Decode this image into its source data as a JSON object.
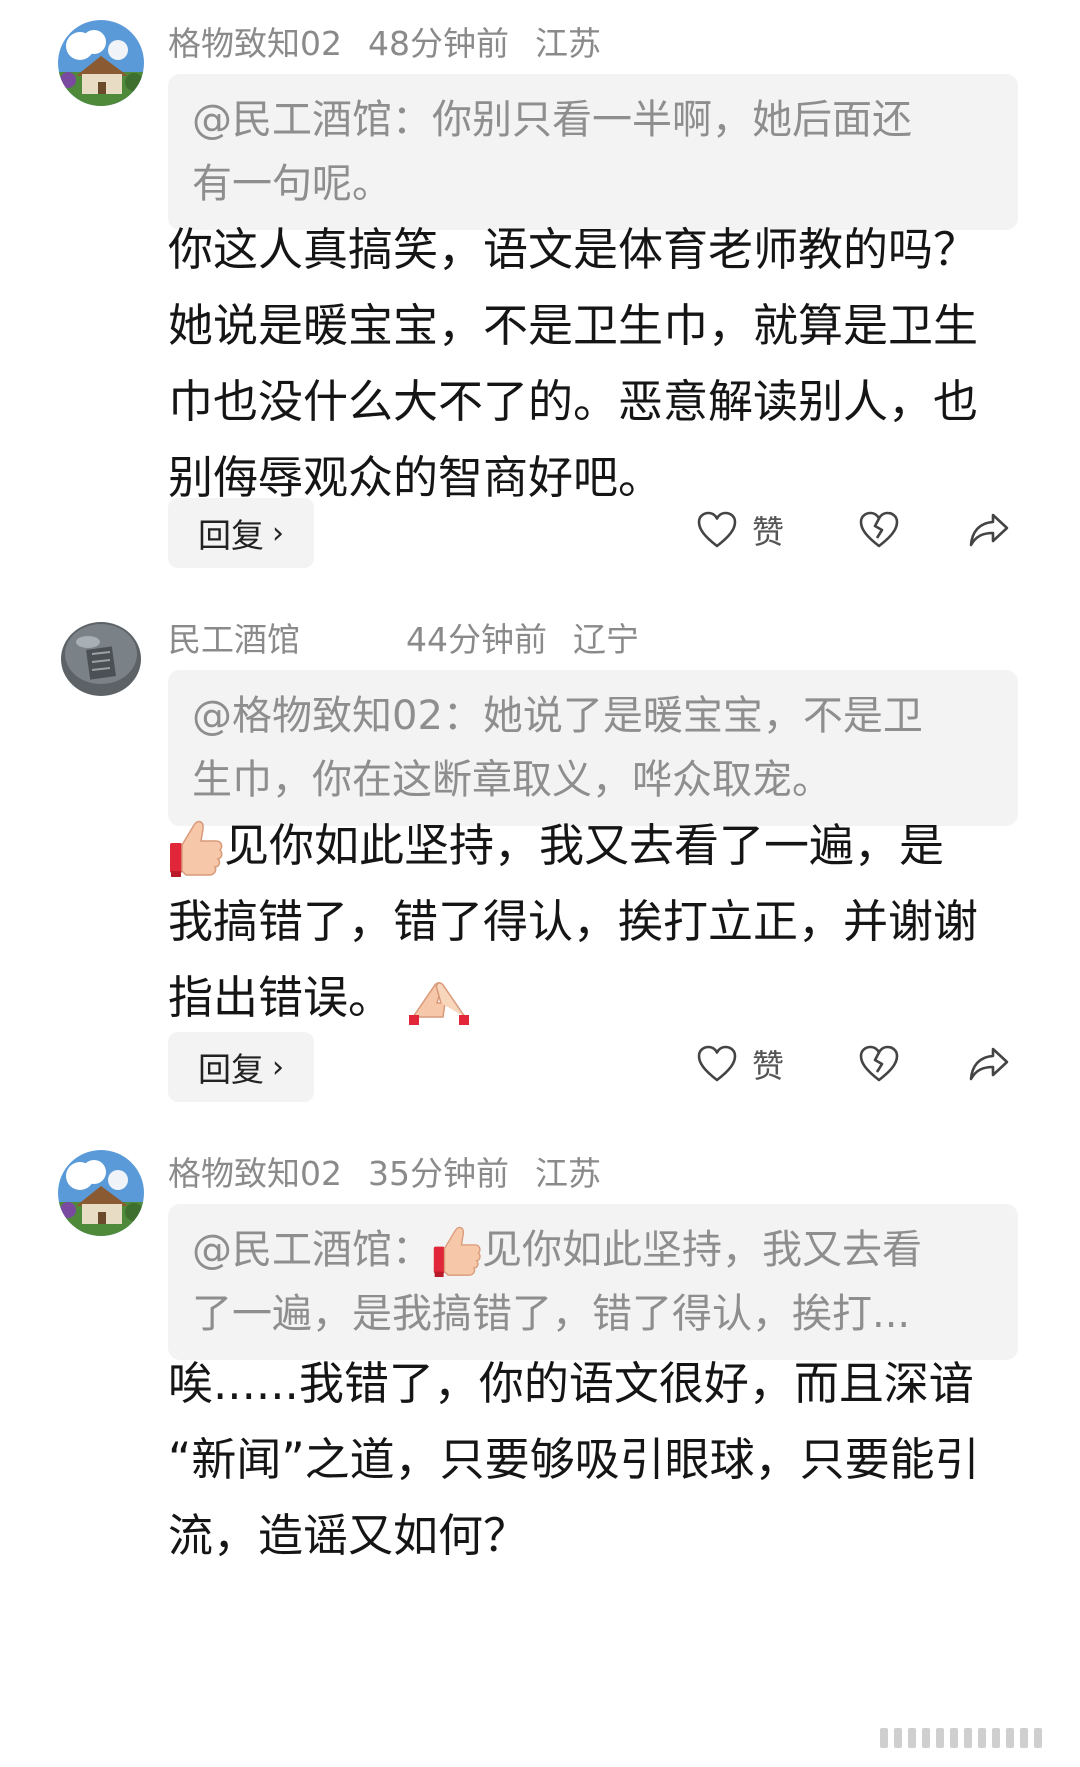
{
  "comments": [
    {
      "username": "格物致知02",
      "time": "48分钟前",
      "location": "江苏",
      "quote_lines": [
        "@民工酒馆：你别只看一半啊，她后面还",
        "有一句呢。"
      ],
      "body_lines": [
        "你这人真搞笑，语文是体育老师教的吗？",
        "她说是暖宝宝，不是卫生巾，就算是卫生",
        "巾也没什么大不了的。恶意解读别人，也",
        "别侮辱观众的智商好吧。"
      ],
      "reply_label": "回复",
      "like_label": "赞"
    },
    {
      "username": "民工酒馆",
      "time": "44分钟前",
      "location": "辽宁",
      "quote_lines": [
        "@格物致知02：她说了是暖宝宝，不是卫",
        "生巾，你在这断章取义，哗众取宠。"
      ],
      "body_line1": "见你如此坚持，我又去看了一遍，是",
      "body_line2": "我搞错了，错了得认，挨打立正，并谢谢",
      "body_line3": "指出错误。",
      "reply_label": "回复",
      "like_label": "赞"
    },
    {
      "username": "格物致知02",
      "time": "35分钟前",
      "location": "江苏",
      "quote_prefix": "@民工酒馆：",
      "quote_line1_rest": "见你如此坚持，我又去看",
      "quote_line2": "了一遍，是我搞错了，错了得认，挨打...",
      "body_lines": [
        "唉......我错了，你的语文很好，而且深谙",
        "“新闻”之道，只要够吸引眼球，只要能引",
        "流，造谣又如何？"
      ]
    }
  ],
  "icons": {
    "reply_chevron": "chevron-right-icon",
    "like": "heart-outline-icon",
    "dislike": "broken-heart-icon",
    "share": "share-arrow-icon",
    "thumbs_up": "thumbs-up-emoji",
    "clap": "praying-hands-emoji"
  },
  "colors": {
    "meta_text": "#8a8a8a",
    "quote_bg": "#f3f3f3",
    "quote_text": "#8e8e8e",
    "body_text": "#151515"
  }
}
